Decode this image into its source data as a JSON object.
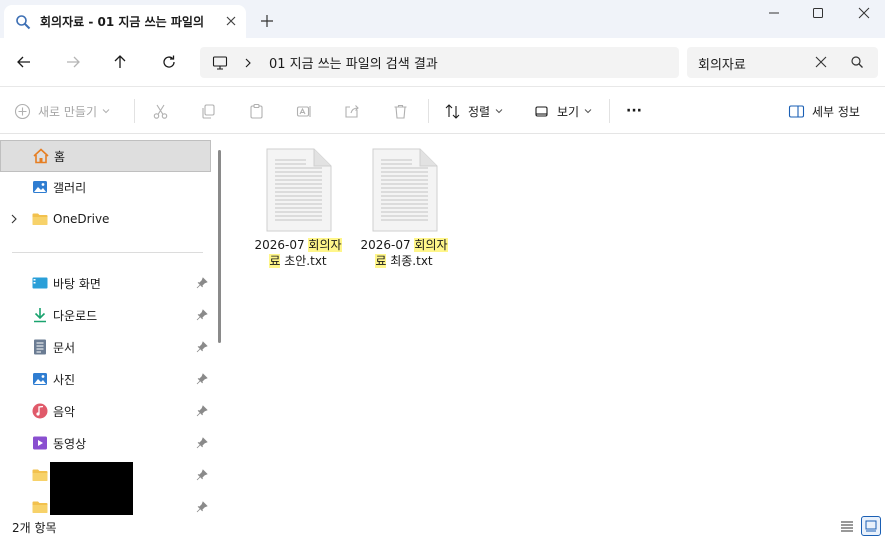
{
  "tab": {
    "title": "회의자료 - 01 지금 쓰는 파일의"
  },
  "address": {
    "path": "01 지금 쓰는 파일의 검색 결과"
  },
  "search": {
    "value": "회의자료"
  },
  "toolbar": {
    "new_label": "새로 만들기",
    "sort_label": "정렬",
    "view_label": "보기",
    "more_label": "···",
    "details_label": "세부 정보"
  },
  "sidebar": {
    "items": [
      {
        "label": "홈",
        "icon": "home-icon"
      },
      {
        "label": "갤러리",
        "icon": "gallery-icon"
      },
      {
        "label": "OneDrive",
        "icon": "folder-icon"
      },
      {
        "label": "바탕 화면",
        "icon": "desktop-icon"
      },
      {
        "label": "다운로드",
        "icon": "download-icon"
      },
      {
        "label": "문서",
        "icon": "document-icon"
      },
      {
        "label": "사진",
        "icon": "pictures-icon"
      },
      {
        "label": "음악",
        "icon": "music-icon"
      },
      {
        "label": "동영상",
        "icon": "video-icon"
      }
    ]
  },
  "files": [
    {
      "pre": "2026-07 ",
      "match1": "회의자",
      "match2": "료",
      "post": " 초안.txt"
    },
    {
      "pre": "2026-07 ",
      "match1": "회의자",
      "match2": "료",
      "post": " 최종.txt"
    }
  ],
  "status": {
    "item_count": "2개 항목"
  },
  "colors": {
    "accent": "#1a5fb4",
    "highlight": "#fff68a",
    "titlebar": "#f0f3f9"
  }
}
